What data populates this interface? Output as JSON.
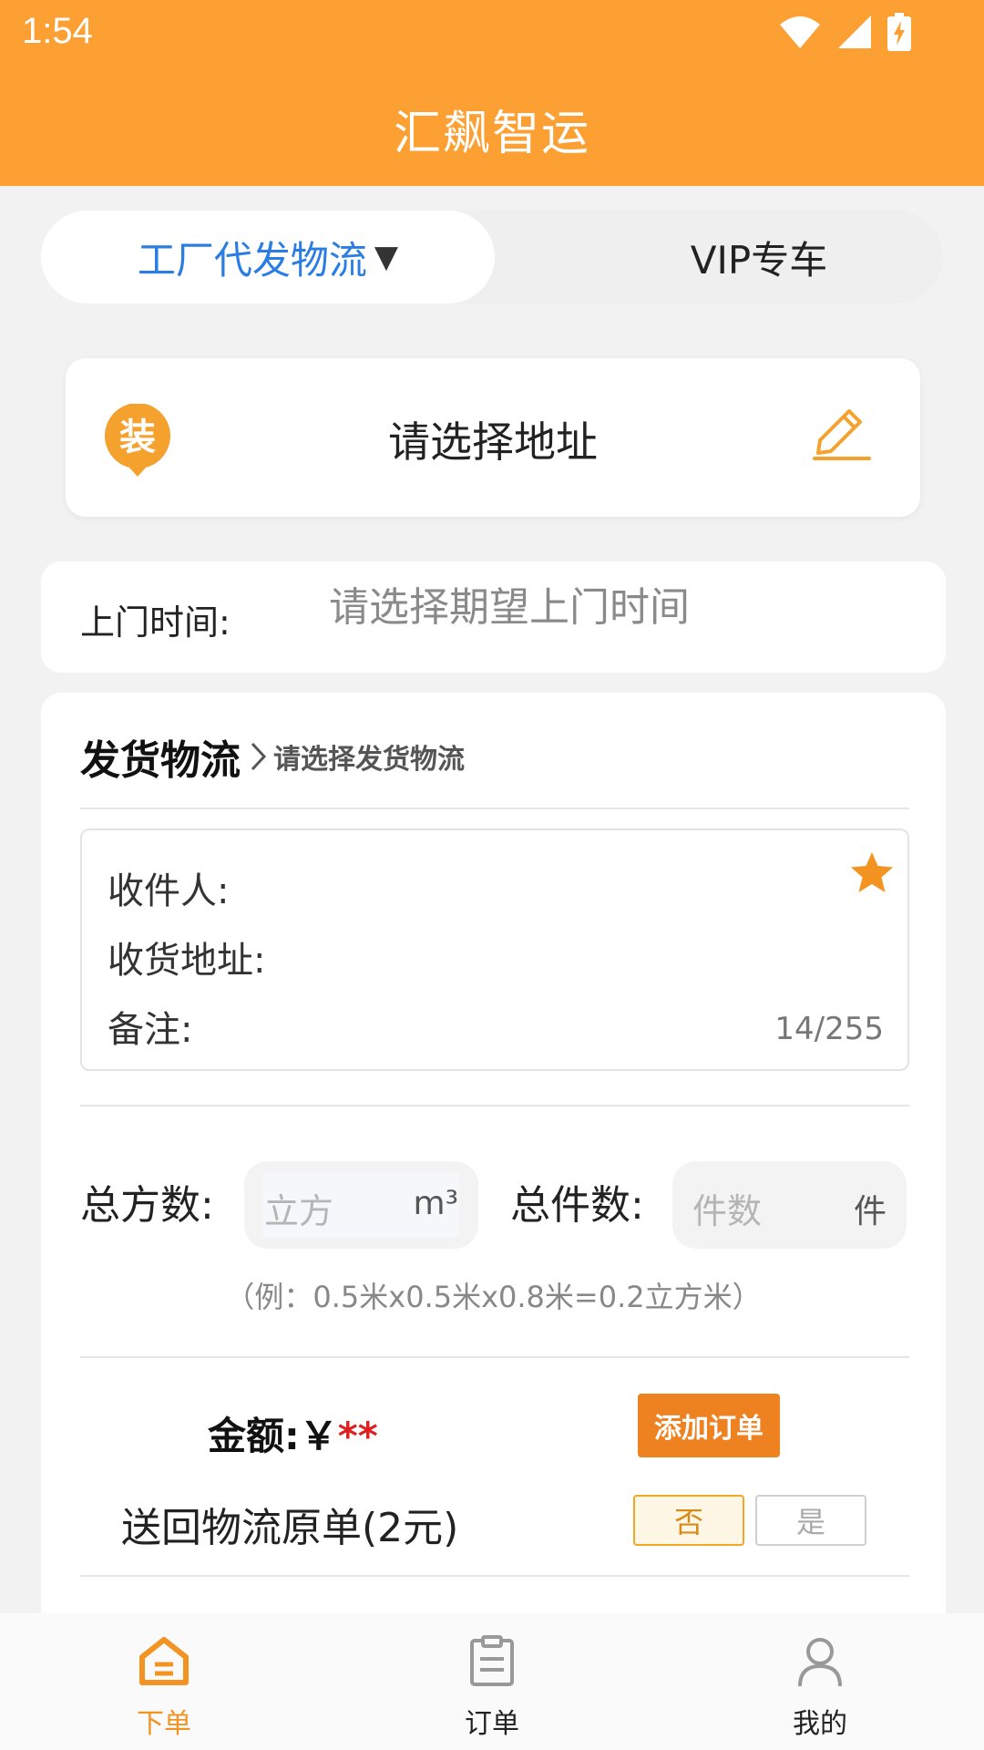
{
  "status_bar": {
    "time": "1:54"
  },
  "app": {
    "title": "汇飙智运"
  },
  "tabs": [
    {
      "label": "工厂代发物流",
      "caret": "▼",
      "active": true
    },
    {
      "label": "VIP专车",
      "active": false
    }
  ],
  "address_card": {
    "badge": "装",
    "placeholder": "请选择地址"
  },
  "pickup_time": {
    "label": "上门时间:",
    "placeholder": "请选择期望上门时间"
  },
  "shipping": {
    "title": "发货物流",
    "subtitle": "请选择发货物流",
    "receiver_label": "收件人:",
    "address_label": "收货地址:",
    "note_label": "备注:",
    "note_counter": "14/255"
  },
  "volume": {
    "label": "总方数:",
    "placeholder": "立方",
    "unit": "m³",
    "count_label": "总件数:",
    "count_placeholder": "件数",
    "count_unit": "件",
    "example": "（例：0.5米x0.5米x0.8米=0.2立方米）"
  },
  "amount": {
    "label": "金额:￥",
    "value": "**",
    "add_button": "添加订单"
  },
  "return_receipt": {
    "label": "送回物流原单(2元)",
    "no": "否",
    "yes": "是",
    "selected": "否"
  },
  "bottom_nav": [
    {
      "label": "下单",
      "icon": "home-icon",
      "active": true
    },
    {
      "label": "订单",
      "icon": "clipboard-icon",
      "active": false
    },
    {
      "label": "我的",
      "icon": "person-icon",
      "active": false
    }
  ],
  "colors": {
    "brand": "#fda033",
    "accent_blue": "#2a7de3",
    "button_orange": "#ee8120",
    "price_red": "#e02020"
  }
}
